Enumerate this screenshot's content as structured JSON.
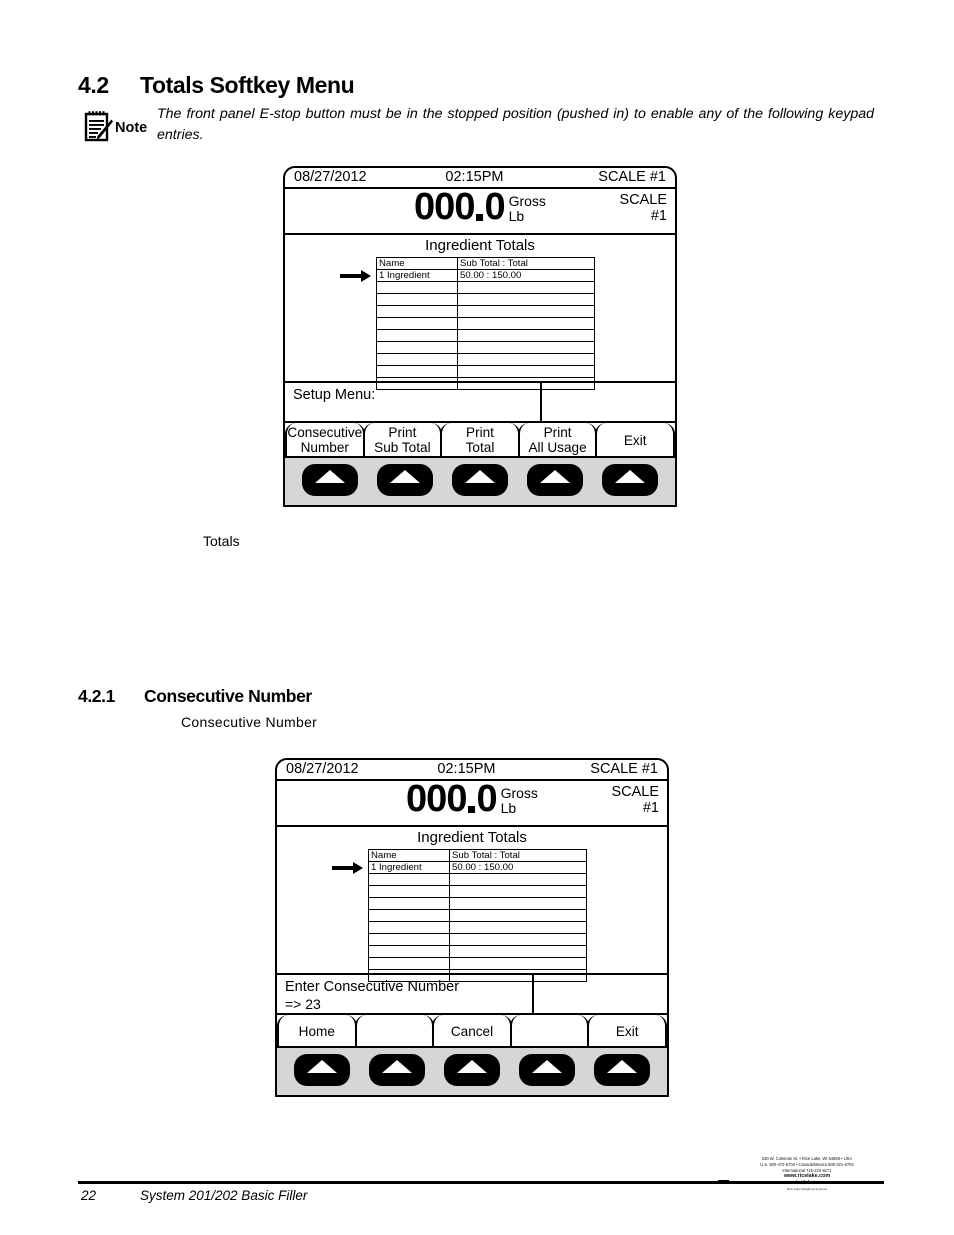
{
  "sections": {
    "main": {
      "number": "4.2",
      "title": "Totals Softkey Menu"
    },
    "sub": {
      "number": "4.2.1",
      "title": "Consecutive Number"
    }
  },
  "note": {
    "icon": "note-pad-pencil-icon",
    "label": "Note",
    "text": "The front panel E-stop button must be in the stopped position (pushed in) to enable any of the following keypad entries."
  },
  "captions": {
    "totals": "Totals",
    "consecutive_number": "Consecutive  Number"
  },
  "panel_totals": {
    "status_bar": {
      "date": "08/27/2012",
      "time": "02:15PM",
      "scale": "SCALE #1"
    },
    "weight": {
      "digits_int": "000",
      "digits_dec": "0",
      "mode": "Gross",
      "units": "Lb"
    },
    "scale_label": {
      "line1": "SCALE",
      "line2": "#1"
    },
    "body_title": "Ingredient Totals",
    "table": {
      "headers": [
        "Name",
        "Sub Total : Total"
      ],
      "rows": [
        [
          "1 Ingredient",
          "50.00 : 150.00"
        ],
        [
          "",
          ""
        ],
        [
          "",
          ""
        ],
        [
          "",
          ""
        ],
        [
          "",
          ""
        ],
        [
          "",
          ""
        ],
        [
          "",
          ""
        ],
        [
          "",
          ""
        ],
        [
          "",
          ""
        ],
        [
          "",
          ""
        ]
      ],
      "selected_row_index": 0,
      "row_pointer_icon": "right-arrow-icon"
    },
    "prompt": {
      "line1": "Setup Menu:",
      "line2": ""
    },
    "softkeys": [
      {
        "line1": "Consecutive",
        "line2": "Number"
      },
      {
        "line1": "Print",
        "line2": "Sub Total"
      },
      {
        "line1": "Print",
        "line2": "Total"
      },
      {
        "line1": "Print",
        "line2": "All Usage"
      },
      {
        "line1": "Exit",
        "line2": ""
      }
    ]
  },
  "panel_consecutive": {
    "status_bar": {
      "date": "08/27/2012",
      "time": "02:15PM",
      "scale": "SCALE #1"
    },
    "weight": {
      "digits_int": "000",
      "digits_dec": "0",
      "mode": "Gross",
      "units": "Lb"
    },
    "scale_label": {
      "line1": "SCALE",
      "line2": "#1"
    },
    "body_title": "Ingredient Totals",
    "table": {
      "headers": [
        "Name",
        "Sub Total : Total"
      ],
      "rows": [
        [
          "1 Ingredient",
          "50.00 : 150.00"
        ],
        [
          "",
          ""
        ],
        [
          "",
          ""
        ],
        [
          "",
          ""
        ],
        [
          "",
          ""
        ],
        [
          "",
          ""
        ],
        [
          "",
          ""
        ],
        [
          "",
          ""
        ],
        [
          "",
          ""
        ],
        [
          "",
          ""
        ]
      ],
      "selected_row_index": 0,
      "row_pointer_icon": "right-arrow-icon"
    },
    "prompt": {
      "line1": "Enter Consecutive Number",
      "line2": "=> 23"
    },
    "softkeys": [
      {
        "line1": "Home",
        "line2": ""
      },
      {
        "line1": "",
        "line2": ""
      },
      {
        "line1": "Cancel",
        "line2": ""
      },
      {
        "line1": "",
        "line2": ""
      },
      {
        "line1": "Exit",
        "line2": ""
      }
    ]
  },
  "footer": {
    "page_number": "22",
    "doc_title": "System 201/202 Basic Filler",
    "address": {
      "line1": "230 W. Coleman St. • Rice Lake, WI 54868 • USA",
      "line2": "U.S. 800-472-6703 • Canada/Mexico 800-321-6703",
      "line3": "International 715-234-9171",
      "web1": "www.ricelake.com",
      "web2": "m.ricelake.com",
      "tagline": "Rice Lake Weighing Systems"
    }
  }
}
